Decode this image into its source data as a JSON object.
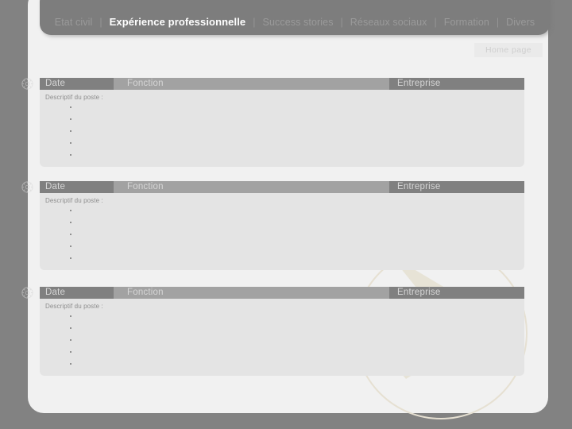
{
  "navbar": {
    "items": [
      {
        "label": "Etat civil",
        "active": false
      },
      {
        "label": "Expérience professionnelle",
        "active": true
      },
      {
        "label": "Success stories",
        "active": false
      },
      {
        "label": "Réseaux sociaux",
        "active": false
      },
      {
        "label": "Formation",
        "active": false
      },
      {
        "label": "Divers",
        "active": false
      }
    ],
    "separator": "|"
  },
  "home_button": {
    "label": "Home page"
  },
  "columns": {
    "date": "Date",
    "fonction": "Fonction",
    "entreprise": "Entreprise"
  },
  "description_label": "Descriptif du poste :",
  "bullet_glyph": "·",
  "blocks": [
    {
      "date": "Date",
      "fonction": "Fonction",
      "entreprise": "Entreprise",
      "description_label": "Descriptif du poste :",
      "bullets": [
        "",
        "",
        "",
        "",
        ""
      ],
      "icon": "gear-icon"
    },
    {
      "date": "Date",
      "fonction": "Fonction",
      "entreprise": "Entreprise",
      "description_label": "Descriptif du poste :",
      "bullets": [
        "",
        "",
        "",
        "",
        ""
      ],
      "icon": "gear-icon"
    },
    {
      "date": "Date",
      "fonction": "Fonction",
      "entreprise": "Entreprise",
      "description_label": "Descriptif du poste :",
      "bullets": [
        "",
        "",
        "",
        "",
        ""
      ],
      "icon": "gear-icon"
    }
  ],
  "colors": {
    "background": "#828282",
    "sheet": "#f1f1f1",
    "navbar": "#7d7d7d",
    "nav_active_text": "#ffffff",
    "nav_text": "#9a9a9a",
    "header_dark": "#808080",
    "header_light": "#a2a2a2",
    "block_body": "#e4e4e4",
    "watermark": "#e6e2d5",
    "home_button_bg": "#eaeaea",
    "home_button_text": "#cfcfcf"
  },
  "watermark": {
    "shape": "arrow-in-circle-logo"
  }
}
